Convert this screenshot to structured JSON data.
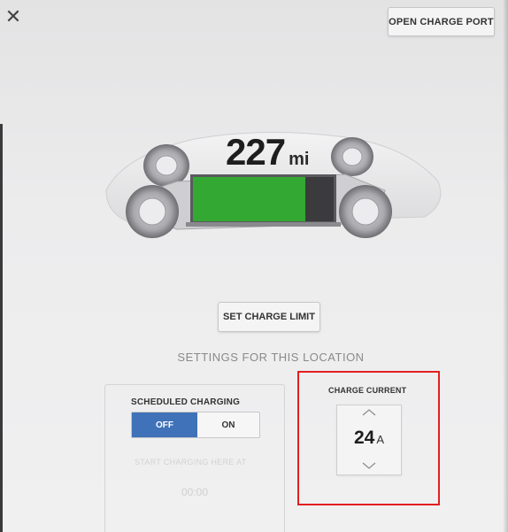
{
  "header": {
    "close_icon": "close-icon",
    "open_charge_port_label": "OPEN CHARGE PORT"
  },
  "vehicle": {
    "range_value": "227",
    "range_unit": "mi",
    "battery_fill_fraction": 0.83,
    "battery_color": "#33a832"
  },
  "charge_limit_button_label": "SET CHARGE LIMIT",
  "settings": {
    "title": "SETTINGS FOR THIS LOCATION",
    "scheduled_charging": {
      "label": "SCHEDULED CHARGING",
      "off_label": "OFF",
      "on_label": "ON",
      "selected": "OFF",
      "start_label": "START CHARGING HERE AT",
      "start_time": "00:00"
    },
    "charge_current": {
      "label": "CHARGE CURRENT",
      "value": "24",
      "unit": "A",
      "up_icon": "chevron-up-icon",
      "down_icon": "chevron-down-icon"
    }
  },
  "colors": {
    "accent_blue": "#3f72b8",
    "highlight_red": "#e41f1f"
  }
}
